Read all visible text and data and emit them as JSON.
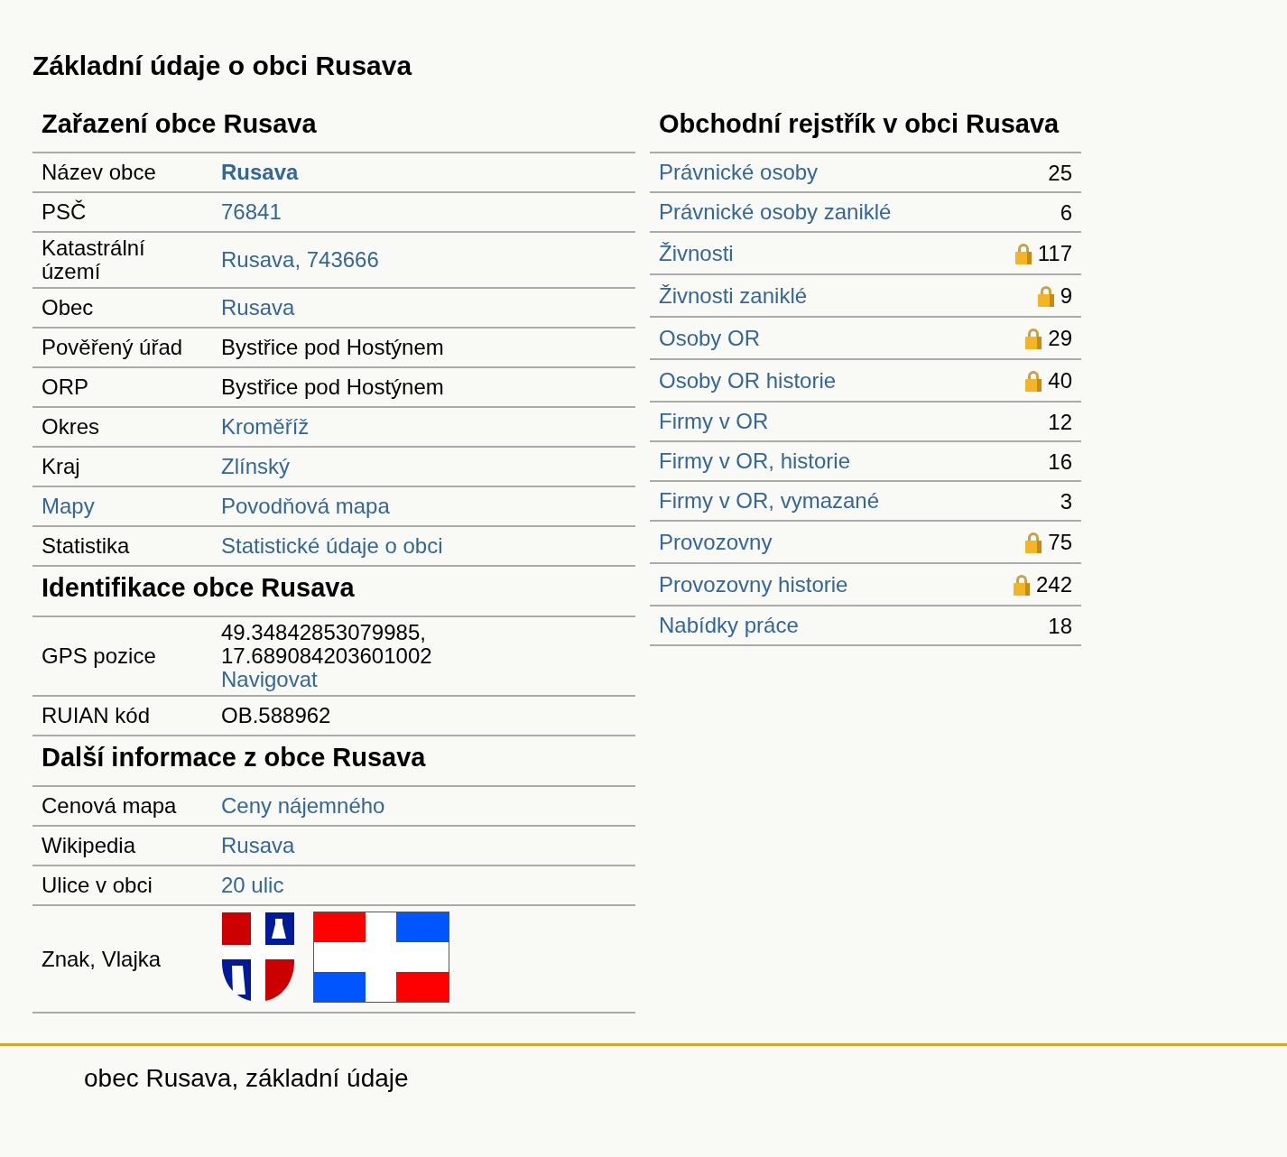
{
  "title": "Základní údaje o obci Rusava",
  "sections": [
    {
      "heading": "Zařazení obce Rusava",
      "rows": [
        {
          "kind": "text",
          "label": "Název obce",
          "label_link": false,
          "lines": [
            {
              "text": "Rusava",
              "link": true,
              "bold": true
            }
          ]
        },
        {
          "kind": "text",
          "label": "PSČ",
          "label_link": false,
          "lines": [
            {
              "text": "76841",
              "link": true,
              "bold": false
            }
          ]
        },
        {
          "kind": "text",
          "label": "Katastrální území",
          "label_link": false,
          "lines": [
            {
              "text": "Rusava, 743666",
              "link": true,
              "bold": false
            }
          ]
        },
        {
          "kind": "text",
          "label": "Obec",
          "label_link": false,
          "lines": [
            {
              "text": "Rusava",
              "link": true,
              "bold": false
            }
          ]
        },
        {
          "kind": "text",
          "label": "Pověřený úřad",
          "label_link": false,
          "lines": [
            {
              "text": "Bystřice pod Hostýnem",
              "link": false,
              "bold": false
            }
          ]
        },
        {
          "kind": "text",
          "label": "ORP",
          "label_link": false,
          "lines": [
            {
              "text": "Bystřice pod Hostýnem",
              "link": false,
              "bold": false
            }
          ]
        },
        {
          "kind": "text",
          "label": "Okres",
          "label_link": false,
          "lines": [
            {
              "text": "Kroměříž",
              "link": true,
              "bold": false
            }
          ]
        },
        {
          "kind": "text",
          "label": "Kraj",
          "label_link": false,
          "lines": [
            {
              "text": "Zlínský",
              "link": true,
              "bold": false
            }
          ]
        },
        {
          "kind": "text",
          "label": "Mapy",
          "label_link": true,
          "lines": [
            {
              "text": "Povodňová mapa",
              "link": true,
              "bold": false
            }
          ]
        },
        {
          "kind": "text",
          "label": "Statistika",
          "label_link": false,
          "lines": [
            {
              "text": "Statistické údaje o obci",
              "link": true,
              "bold": false
            }
          ]
        }
      ]
    },
    {
      "heading": "Identifikace obce Rusava",
      "rows": [
        {
          "kind": "text",
          "label": "GPS pozice",
          "label_link": false,
          "lines": [
            {
              "text": "49.34842853079985,",
              "link": false,
              "bold": false
            },
            {
              "text": "17.689084203601002",
              "link": false,
              "bold": false
            },
            {
              "text": "Navigovat",
              "link": true,
              "bold": false
            }
          ]
        },
        {
          "kind": "text",
          "label": "RUIAN kód",
          "label_link": false,
          "lines": [
            {
              "text": "OB.588962",
              "link": false,
              "bold": false
            }
          ]
        }
      ]
    },
    {
      "heading": "Další informace z obce Rusava",
      "rows": [
        {
          "kind": "text",
          "label": "Cenová mapa",
          "label_link": false,
          "lines": [
            {
              "text": "Ceny nájemného",
              "link": true,
              "bold": false
            }
          ]
        },
        {
          "kind": "text",
          "label": "Wikipedia",
          "label_link": false,
          "lines": [
            {
              "text": "Rusava",
              "link": true,
              "bold": false
            }
          ]
        },
        {
          "kind": "text",
          "label": "Ulice v obci",
          "label_link": false,
          "lines": [
            {
              "text": "20 ulic",
              "link": true,
              "bold": false
            }
          ]
        },
        {
          "kind": "emblems",
          "label": "Znak, Vlajka",
          "label_link": false
        }
      ]
    }
  ],
  "register": {
    "heading": "Obchodní rejstřík v obci Rusava",
    "rows": [
      {
        "label": "Právnické osoby",
        "count": "25",
        "locked": false
      },
      {
        "label": "Právnické osoby zaniklé",
        "count": "6",
        "locked": false
      },
      {
        "label": "Živnosti",
        "count": "117",
        "locked": true
      },
      {
        "label": "Živnosti zaniklé",
        "count": "9",
        "locked": true
      },
      {
        "label": "Osoby OR",
        "count": "29",
        "locked": true
      },
      {
        "label": "Osoby OR historie",
        "count": "40",
        "locked": true
      },
      {
        "label": "Firmy v OR",
        "count": "12",
        "locked": false
      },
      {
        "label": "Firmy v OR, historie",
        "count": "16",
        "locked": false
      },
      {
        "label": "Firmy v OR, vymazané",
        "count": "3",
        "locked": false
      },
      {
        "label": "Provozovny",
        "count": "75",
        "locked": true
      },
      {
        "label": "Provozovny historie",
        "count": "242",
        "locked": true
      },
      {
        "label": "Nabídky práce",
        "count": "18",
        "locked": false
      }
    ]
  },
  "footer": "obec Rusava, základní údaje"
}
